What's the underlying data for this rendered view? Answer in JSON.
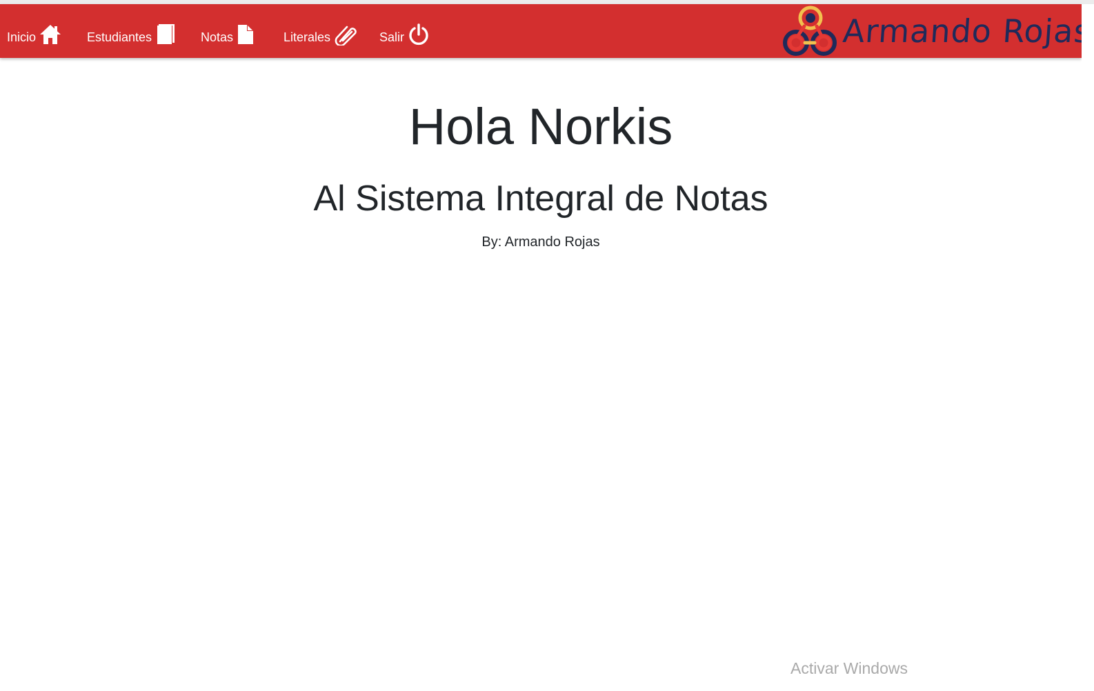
{
  "nav": {
    "items": [
      {
        "label": "Inicio",
        "icon": "home-icon"
      },
      {
        "label": "Estudiantes",
        "icon": "book-icon"
      },
      {
        "label": "Notas",
        "icon": "file-icon"
      },
      {
        "label": "Literales",
        "icon": "paperclip-icon"
      },
      {
        "label": "Salir",
        "icon": "power-icon"
      }
    ],
    "brand": {
      "name": "Armando Rojas",
      "logo": "tricircle-logo"
    }
  },
  "main": {
    "heading": "Hola Norkis",
    "subheading": "Al Sistema Integral de Notas",
    "byline": "By: Armando Rojas"
  },
  "watermark": {
    "text": "Activar Windows"
  },
  "colors": {
    "navbar": "#d32f2f",
    "nav_text": "#ffffff",
    "brand_text": "#1f2a5a",
    "body_text": "#212529",
    "watermark": "#a9a9a9"
  }
}
